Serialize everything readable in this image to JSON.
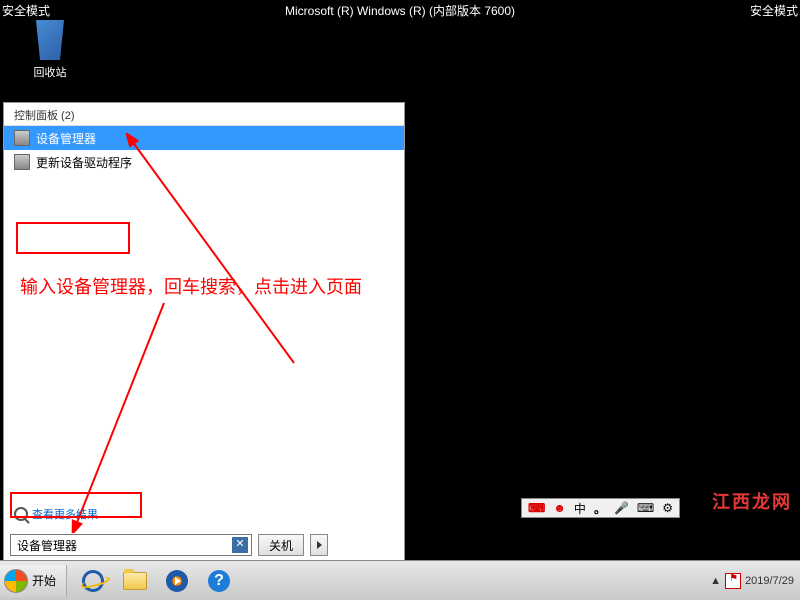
{
  "safe_mode_label": "安全模式",
  "windows_title": "Microsoft (R) Windows (R) (内部版本 7600)",
  "recycle_bin": "回收站",
  "start_menu": {
    "control_panel_header": "控制面板 (2)",
    "results": [
      {
        "label": "设备管理器",
        "selected": true
      },
      {
        "label": "更新设备驱动程序",
        "selected": false
      }
    ],
    "more_results": "查看更多结果",
    "search_value": "设备管理器",
    "shutdown_label": "关机"
  },
  "annotation_text": "输入设备管理器，回车搜索，点击进入页面",
  "taskbar": {
    "start_label": "开始"
  },
  "ime": {
    "zhong": "中",
    "dot": "。"
  },
  "systray": {
    "time": "2019/7/29"
  },
  "watermark": "江西龙网"
}
